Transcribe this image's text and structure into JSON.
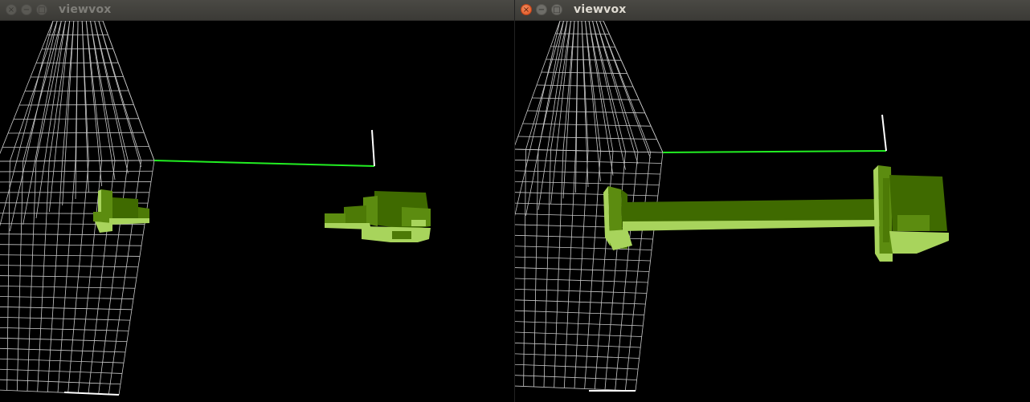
{
  "windows": [
    {
      "title": "viewvox",
      "buttons": {
        "close": "×",
        "minimize": "−",
        "maximize": "□"
      },
      "focused": false
    },
    {
      "title": "viewvox",
      "buttons": {
        "close": "×",
        "minimize": "−",
        "maximize": "□"
      },
      "focused": true
    }
  ],
  "colors": {
    "background": "#000000",
    "grid": "#c8c8c8",
    "axis_green": "#22ee22",
    "axis_white": "#ffffff",
    "voxel_dark": "#3f6a00",
    "voxel_mid": "#5c8c10",
    "voxel_light": "#a8d45c"
  }
}
